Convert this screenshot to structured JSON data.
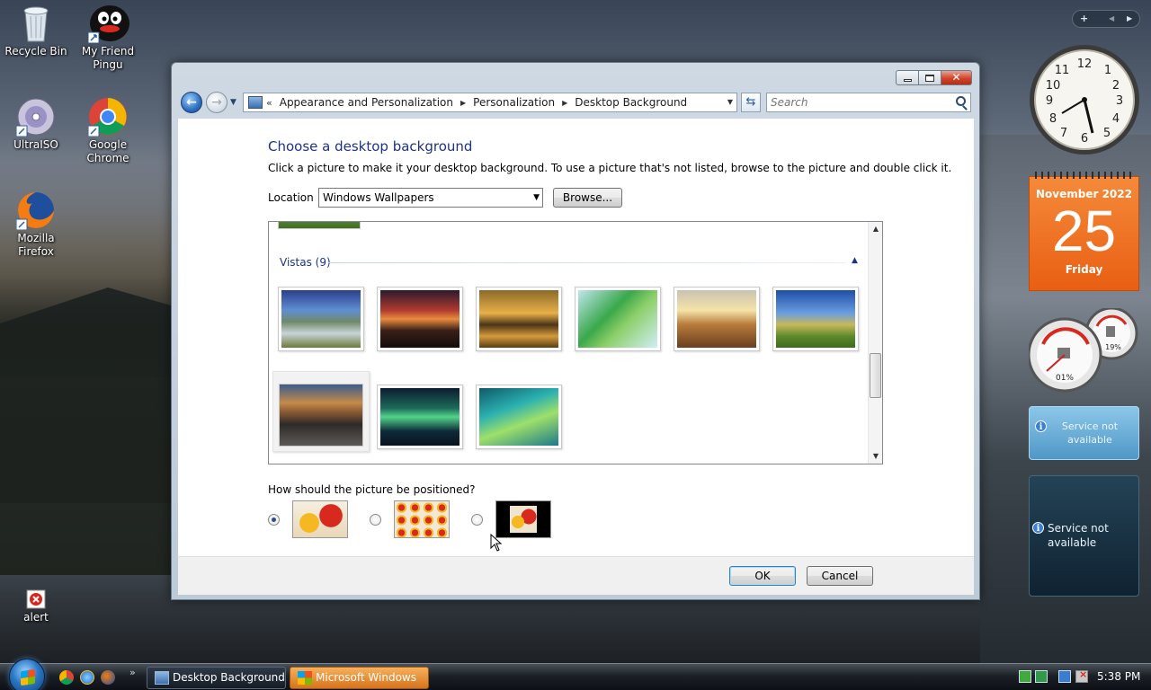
{
  "desktop": {
    "icons": [
      {
        "label": "Recycle Bin",
        "icon": "recycle-bin-icon"
      },
      {
        "label": "My Friend Pingu",
        "icon": "pingu-icon"
      },
      {
        "label": "UltraISO",
        "icon": "ultraiso-icon"
      },
      {
        "label": "Google Chrome",
        "icon": "chrome-icon"
      },
      {
        "label": "Mozilla Firefox",
        "icon": "firefox-icon"
      },
      {
        "label": "alert",
        "icon": "alert-icon"
      }
    ]
  },
  "sidebar": {
    "calendar": {
      "month": "November 2022",
      "day": "25",
      "weekday": "Friday"
    },
    "meters": {
      "cpu": "01%",
      "memory": "19%"
    },
    "weather_small": {
      "text": "Service not available"
    },
    "weather_large": {
      "text": "Service not available"
    }
  },
  "window": {
    "breadcrumb": [
      "Appearance and Personalization",
      "Personalization",
      "Desktop Background"
    ],
    "search_placeholder": "Search",
    "heading": "Choose a desktop background",
    "subtext": "Click a picture to make it your desktop background. To use a picture that's not listed, browse to the picture and double click it.",
    "location_label": "Location",
    "location_value": "Windows Wallpapers",
    "browse_label": "Browse...",
    "group_label": "Vistas (9)",
    "position_question": "How should the picture be positioned?",
    "position_options": [
      "fit-to-screen",
      "tile",
      "center"
    ],
    "ok_label": "OK",
    "cancel_label": "Cancel"
  },
  "taskbar": {
    "buttons": [
      "Desktop Background",
      "Microsoft Windows"
    ],
    "clock": "5:38 PM"
  },
  "colors": {
    "heading": "#1e3287",
    "calendar": "#e95f13",
    "taskbar_flash": "#d7731c"
  }
}
